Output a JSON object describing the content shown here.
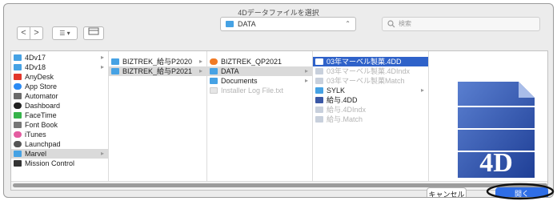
{
  "window": {
    "title": "4Dデータファイルを選択"
  },
  "toolbar": {
    "back": "<",
    "forward": ">",
    "view_mode": "☰ ▾",
    "location": "DATA",
    "search_placeholder": "検索"
  },
  "sidebar": {
    "items": [
      {
        "label": "4Dv17",
        "icon": "folder-icon",
        "color": "#46a2e4"
      },
      {
        "label": "4Dv18",
        "icon": "folder-icon",
        "color": "#46a2e4"
      },
      {
        "label": "AnyDesk",
        "icon": "anydesk-icon",
        "color": "#e2372b"
      },
      {
        "label": "App Store",
        "icon": "app-store-icon",
        "color": "#2a8af4"
      },
      {
        "label": "Automator",
        "icon": "automator-icon",
        "color": "#6b6b6b"
      },
      {
        "label": "Dashboard",
        "icon": "dashboard-icon",
        "color": "#222222"
      },
      {
        "label": "FaceTime",
        "icon": "facetime-icon",
        "color": "#36b34a"
      },
      {
        "label": "Font Book",
        "icon": "font-book-icon",
        "color": "#777777"
      },
      {
        "label": "iTunes",
        "icon": "itunes-icon",
        "color": "#e45ca0"
      },
      {
        "label": "Launchpad",
        "icon": "launchpad-icon",
        "color": "#555555"
      },
      {
        "label": "Marvel",
        "icon": "folder-icon",
        "color": "#46a2e4"
      },
      {
        "label": "Mission Control",
        "icon": "mission-control-icon",
        "color": "#333333"
      }
    ]
  },
  "col2": {
    "items": [
      {
        "label": "BIZTREK_給与P2020"
      },
      {
        "label": "BIZTREK_給与P2021"
      }
    ]
  },
  "col3": {
    "items": [
      {
        "label": "BIZTREK_QP2021",
        "icon": "app-icon"
      },
      {
        "label": "DATA",
        "icon": "folder-icon"
      },
      {
        "label": "Documents",
        "icon": "folder-icon"
      },
      {
        "label": "Installer Log File.txt",
        "icon": "text-file-icon"
      }
    ]
  },
  "col4": {
    "items": [
      {
        "label": "03年マーベル製菓.4DD"
      },
      {
        "label": "03年マーベル製菓.4DIndx"
      },
      {
        "label": "03年マーベル製菓Match"
      },
      {
        "label": "SYLK"
      },
      {
        "label": "給与.4DD"
      },
      {
        "label": "給与.4DIndx"
      },
      {
        "label": "給与.Match"
      }
    ]
  },
  "preview": {
    "logo_text": "4D"
  },
  "buttons": {
    "cancel": "キャンセル",
    "open": "開く"
  }
}
